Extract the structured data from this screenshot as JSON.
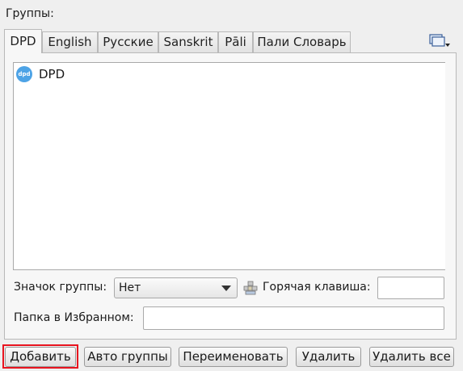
{
  "header": {
    "groups_label": "Группы:"
  },
  "tabs": [
    {
      "label": "DPD",
      "active": true
    },
    {
      "label": "English",
      "active": false
    },
    {
      "label": "Русские",
      "active": false
    },
    {
      "label": "Sanskrit",
      "active": false
    },
    {
      "label": "Pāli",
      "active": false
    },
    {
      "label": "Пали Словарь",
      "active": false
    }
  ],
  "tab_menu_icon": "tab-list-icon",
  "group_list": {
    "items": [
      {
        "label": "DPD",
        "icon": "dpd-logo-icon",
        "icon_text": "dpd"
      }
    ]
  },
  "group_icon": {
    "label": "Значок группы:",
    "value": "Нет"
  },
  "hotkey": {
    "icon": "hotkey-icon",
    "label": "Горячая клавиша:",
    "value": ""
  },
  "favorites_folder": {
    "label": "Папка в Избранном:",
    "value": ""
  },
  "buttons": {
    "add": "Добавить",
    "auto_groups": "Авто группы",
    "rename": "Переименовать",
    "delete": "Удалить",
    "delete_all": "Удалить все"
  },
  "colors": {
    "highlight": "#e8141f",
    "dpd_logo": "#4da3e6",
    "background": "#efefef"
  }
}
